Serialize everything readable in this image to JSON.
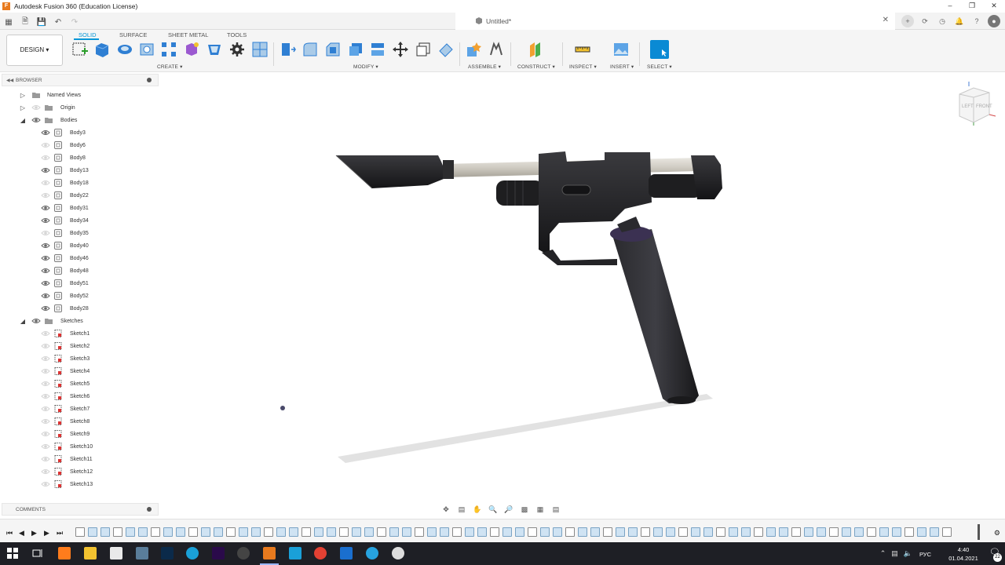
{
  "window": {
    "title": "Autodesk Fusion 360 (Education License)",
    "app_icon_letter": "F"
  },
  "tabbar": {
    "doc_title": "Untitled*"
  },
  "toolbar": {
    "workspace": "DESIGN",
    "tabs": [
      "SOLID",
      "SURFACE",
      "SHEET METAL",
      "TOOLS"
    ],
    "active_tab": "SOLID",
    "groups": {
      "create": "CREATE",
      "modify": "MODIFY",
      "assemble": "ASSEMBLE",
      "construct": "CONSTRUCT",
      "inspect": "INSPECT",
      "insert": "INSERT",
      "select": "SELECT"
    },
    "accent": "#0696d7"
  },
  "browser": {
    "title": "BROWSER",
    "named_views": "Named Views",
    "origin": "Origin",
    "bodies_folder": "Bodies",
    "bodies": [
      "Body3",
      "Body6",
      "Body8",
      "Body13",
      "Body18",
      "Body22",
      "Body31",
      "Body34",
      "Body35",
      "Body40",
      "Body46",
      "Body48",
      "Body51",
      "Body52",
      "Body28"
    ],
    "bodies_visible": [
      true,
      false,
      false,
      true,
      false,
      false,
      true,
      true,
      false,
      true,
      true,
      true,
      true,
      true,
      true
    ],
    "sketches_folder": "Sketches",
    "sketches": [
      "Sketch1",
      "Sketch2",
      "Sketch3",
      "Sketch4",
      "Sketch5",
      "Sketch6",
      "Sketch7",
      "Sketch8",
      "Sketch9",
      "Sketch10",
      "Sketch11",
      "Sketch12",
      "Sketch13"
    ]
  },
  "comments": {
    "title": "COMMENTS"
  },
  "viewcube": {
    "left": "LEFT",
    "front": "FRONT"
  },
  "taskbar": {
    "time": "4:40",
    "date": "01.04.2021",
    "language": "РУС",
    "notifications": "22"
  }
}
